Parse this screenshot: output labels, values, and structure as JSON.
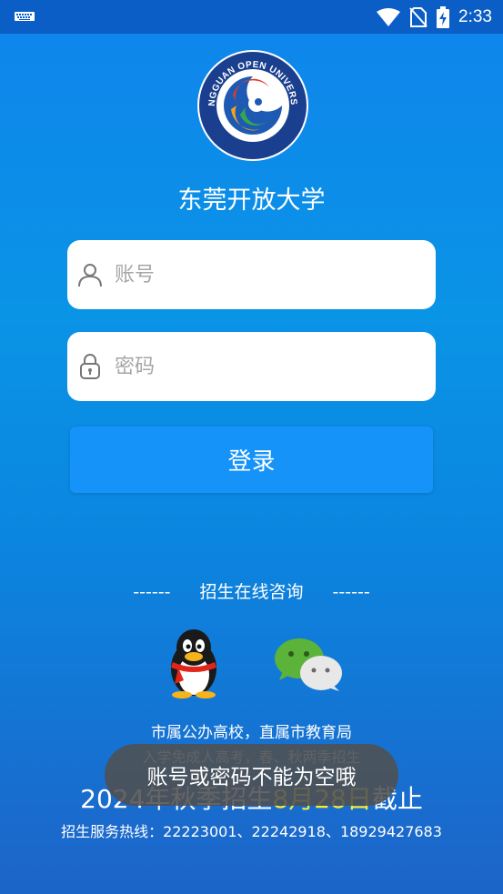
{
  "status_bar": {
    "time": "2:33",
    "icons": [
      "keyboard-icon",
      "wifi-icon",
      "no-sim-icon",
      "battery-charging-icon"
    ]
  },
  "logo": {
    "ring_text": "DONGGUAN OPEN UNIVERSITY",
    "bottom_text": "东莞开放大学"
  },
  "school_name": "东莞开放大学",
  "login": {
    "account_placeholder": "账号",
    "password_placeholder": "密码",
    "login_label": "登录"
  },
  "consult": {
    "dashes_left": "------",
    "title": "招生在线咨询",
    "dashes_right": "------",
    "qq_icon": "qq-penguin-icon",
    "wechat_icon": "wechat-icon"
  },
  "info": {
    "line1": "市属公办高校，直属市教育局",
    "line2": "入学免成人高考，春、秋两季招生",
    "line3_prefix": "2024年秋季招生",
    "line3_date": "8月28日",
    "line3_suffix": "截止",
    "hotline": "招生服务热线：22223001、22242918、18929427683"
  },
  "toast": "账号或密码不能为空哦",
  "colors": {
    "status_bar": "#0b5ec6",
    "background_top": "#0f84ec",
    "background_bottom": "#1d64c8",
    "login_button": "#1593f9",
    "highlight": "#f3ee3a"
  }
}
